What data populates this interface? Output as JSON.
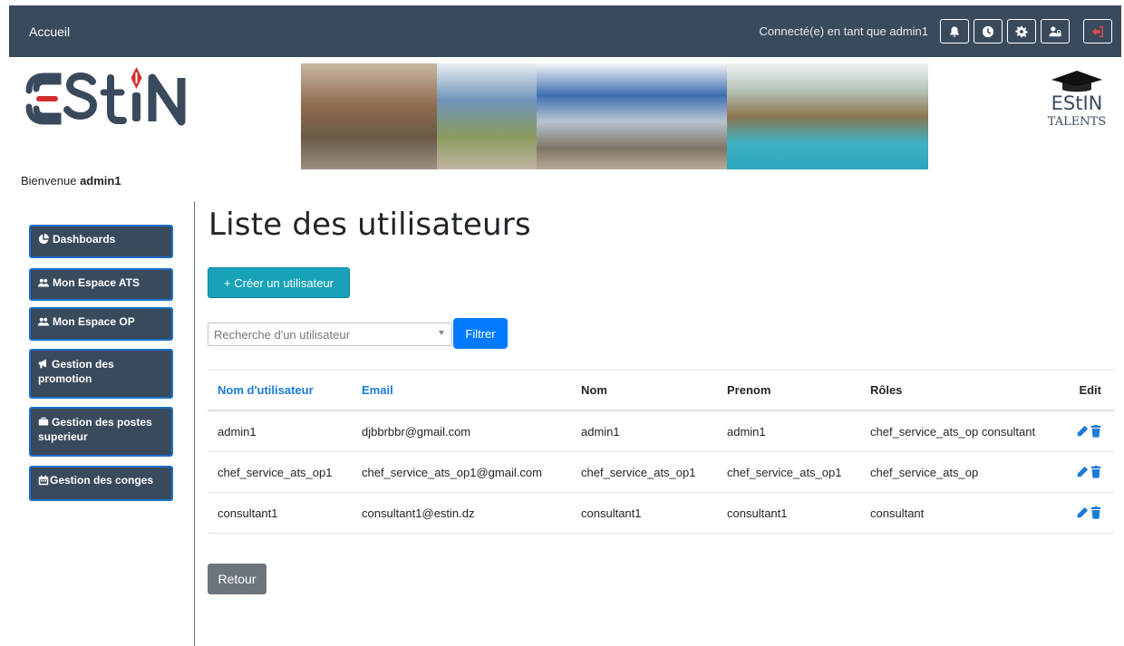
{
  "navbar": {
    "home": "Accueil",
    "status": "Connecté(e) en tant que admin1",
    "icons": [
      "bell-icon",
      "clock-icon",
      "gear-icon",
      "user-lock-icon",
      "sign-out-icon"
    ]
  },
  "header": {
    "logo_text": "ESTIN",
    "talents_top": "EStIN",
    "talents_bottom": "TALENTS",
    "welcome_prefix": "Bienvenue",
    "welcome_user": "admin1"
  },
  "sidebar": {
    "items": [
      {
        "label": "Dashboards",
        "icon": "chart-pie-icon"
      },
      {
        "label": "Mon Espace ATS",
        "icon": "users-icon"
      },
      {
        "label": "Mon Espace OP",
        "icon": "users-icon"
      },
      {
        "label": "Gestion des promotion",
        "icon": "bullhorn-icon"
      },
      {
        "label": "Gestion des postes superieur",
        "icon": "briefcase-icon"
      },
      {
        "label": "Gestion des conges",
        "icon": "calendar-icon"
      }
    ]
  },
  "main": {
    "title": "Liste des utilisateurs",
    "create_label": "+ Créer un utilisateur",
    "search_placeholder": "Recherche d'un utilisateur",
    "filter_label": "Filtrer",
    "back_label": "Retour"
  },
  "table": {
    "headers": [
      "Nom d'utilisateur",
      "Email",
      "Nom",
      "Prenom",
      "Rôles",
      "Edit"
    ],
    "rows": [
      [
        "admin1",
        "djbbrbbr@gmail.com",
        "admin1",
        "admin1",
        "chef_service_ats_op consultant"
      ],
      [
        "chef_service_ats_op1",
        "chef_service_ats_op1@gmail.com",
        "chef_service_ats_op1",
        "chef_service_ats_op1",
        "chef_service_ats_op"
      ],
      [
        "consultant1",
        "consultant1@estin.dz",
        "consultant1",
        "consultant1",
        "consultant"
      ]
    ]
  },
  "colors": {
    "navbar_bg": "#3a4a5d",
    "accent": "#1b7bd6",
    "create_btn": "#17a2b8",
    "filter_btn": "#007bff",
    "back_btn": "#6c757d",
    "logo_red": "#d32f2f"
  }
}
